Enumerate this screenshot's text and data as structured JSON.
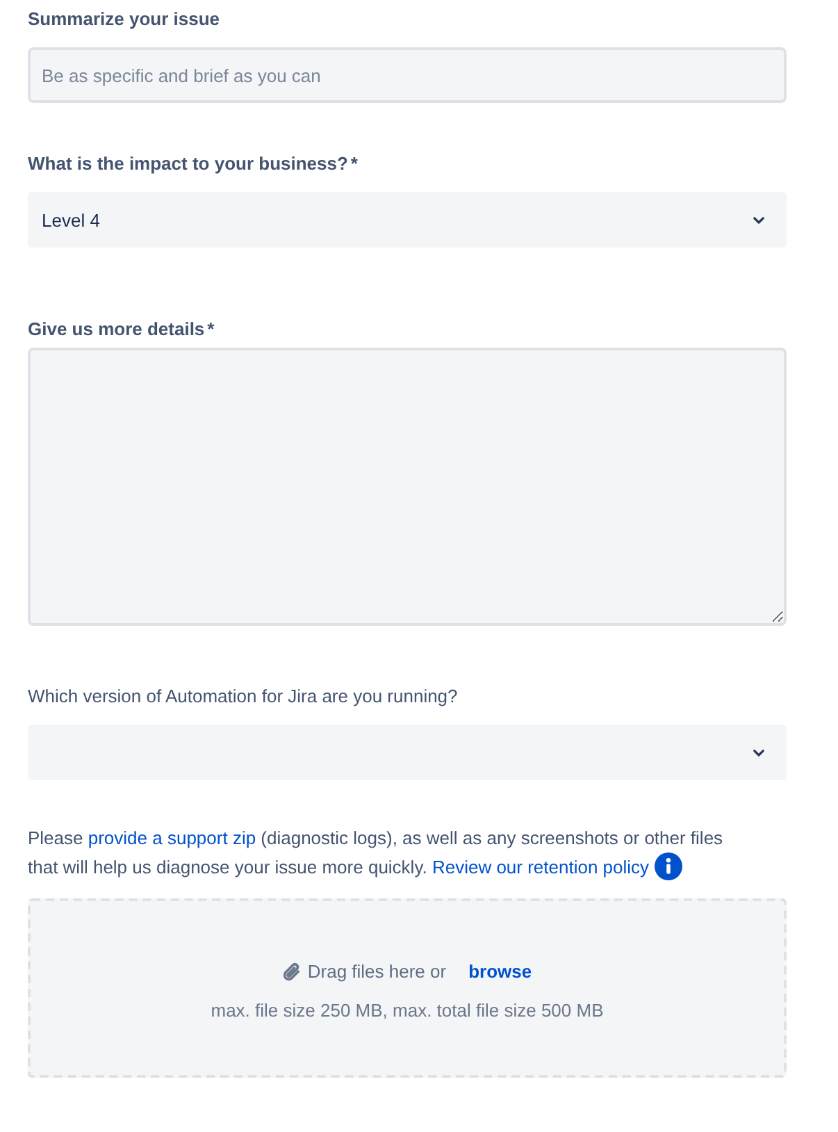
{
  "fields": [
    {
      "kind": "text",
      "label": "Summarize your issue",
      "placeholder": "Be as specific and brief as you can"
    },
    {
      "kind": "select",
      "label": "What is the impact to your business?",
      "required_mark": "*",
      "value": "Level 4"
    },
    {
      "kind": "textarea",
      "label": "Give us more details",
      "required_mark": "*"
    },
    {
      "kind": "select",
      "label": "Which version of Automation for Jira are you running?"
    }
  ],
  "attachments": {
    "note": [
      {
        "kind": "text",
        "text": "Please "
      },
      {
        "kind": "link",
        "text": "provide a support zip"
      },
      {
        "kind": "text",
        "text": " (diagnostic logs), as well as any screenshots or other files that will help us diagnose your issue more quickly. "
      },
      {
        "kind": "link",
        "text": "Review our retention policy"
      }
    ],
    "drop_zone": {
      "prompt": "Drag files here or",
      "browse": "browse",
      "limits": "max. file size 250 MB, max. total file size 500 MB"
    }
  }
}
